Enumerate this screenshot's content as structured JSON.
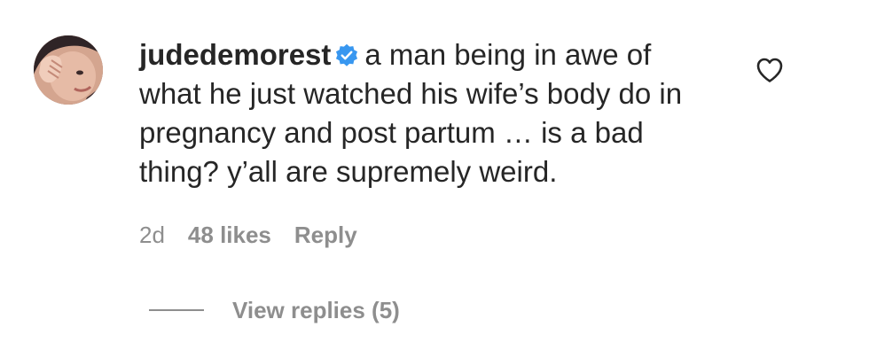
{
  "comment": {
    "username": "judedemorest",
    "verified_icon": "verified-badge-icon",
    "text": "a man being in awe of what he just watched his wife’s body do in pregnancy and post partum … is a bad thing? y’all are supremely weird.",
    "timestamp": "2d",
    "likes": "48 likes",
    "reply_label": "Reply",
    "view_replies": "View replies (5)",
    "like_icon": "heart-outline-icon",
    "colors": {
      "text": "#262626",
      "muted": "#8e8e8e",
      "verified": "#3897f0"
    }
  }
}
